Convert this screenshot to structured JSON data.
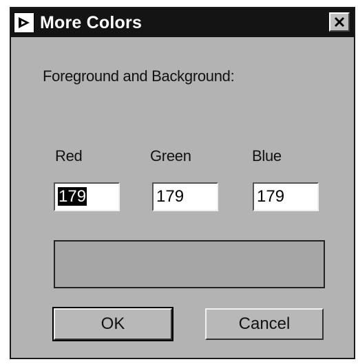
{
  "window": {
    "title": "More Colors",
    "close_symbol": "✕"
  },
  "prompt": "Foreground and Background:",
  "channels": {
    "red": {
      "label": "Red",
      "value": "179"
    },
    "green": {
      "label": "Green",
      "value": "179"
    },
    "blue": {
      "label": "Blue",
      "value": "179"
    }
  },
  "preview_color": "#a6a6a6",
  "buttons": {
    "ok": "OK",
    "cancel": "Cancel"
  },
  "icons": {
    "app": "labview-arrow-icon",
    "close": "close-icon"
  }
}
